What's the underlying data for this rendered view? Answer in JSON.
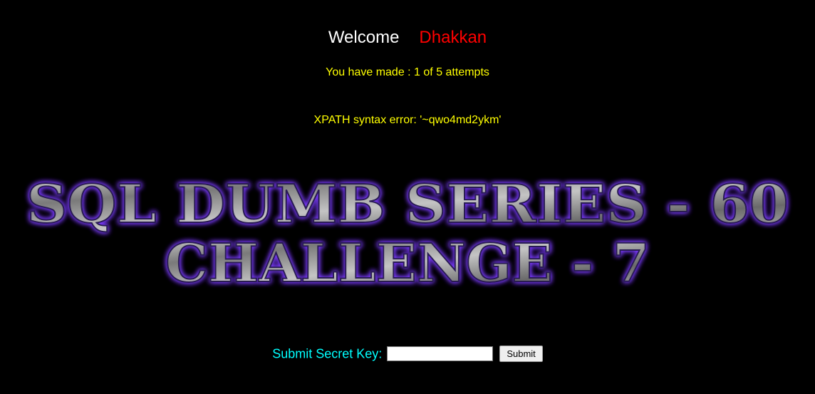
{
  "welcome": {
    "greeting": "Welcome",
    "username": "Dhakkan"
  },
  "attempts_text": "You have made : 1 of 5 attempts",
  "error_text": "XPATH syntax error: '~qwo4md2ykm'",
  "banner": {
    "line1": "SQL DUMB SERIES - 60",
    "line2": "CHALLENGE - 7"
  },
  "form": {
    "label": "Submit Secret Key:",
    "input_value": "",
    "submit_label": "Submit"
  },
  "colors": {
    "background": "#000000",
    "greeting": "#ffffff",
    "username": "#ff0000",
    "attempts": "#ffff00",
    "error": "#ffff00",
    "label": "#00ffff",
    "banner_glow": "#7b3cff",
    "banner_metal": "#9a9a9a"
  }
}
